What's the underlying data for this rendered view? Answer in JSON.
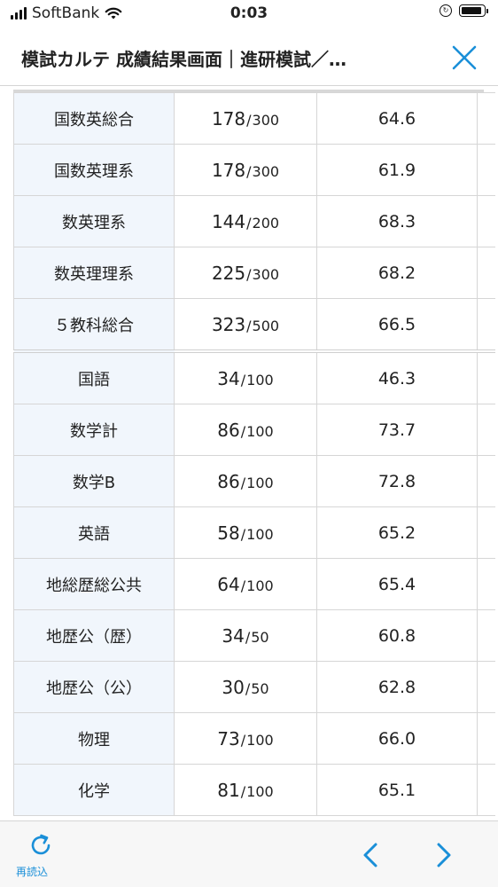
{
  "status_bar": {
    "carrier": "SoftBank",
    "time": "0:03"
  },
  "header": {
    "title": "模試カルテ 成績結果画面｜進研模試／…"
  },
  "table": {
    "rows": [
      {
        "subject": "国数英総合",
        "score": "178",
        "max": "300",
        "deviation": "64.6",
        "separator_before": false
      },
      {
        "subject": "国数英理系",
        "score": "178",
        "max": "300",
        "deviation": "61.9",
        "separator_before": false
      },
      {
        "subject": "数英理系",
        "score": "144",
        "max": "200",
        "deviation": "68.3",
        "separator_before": false
      },
      {
        "subject": "数英理理系",
        "score": "225",
        "max": "300",
        "deviation": "68.2",
        "separator_before": false
      },
      {
        "subject": "５教科総合",
        "score": "323",
        "max": "500",
        "deviation": "66.5",
        "separator_before": false
      },
      {
        "subject": "国語",
        "score": "34",
        "max": "100",
        "deviation": "46.3",
        "separator_before": true
      },
      {
        "subject": "数学計",
        "score": "86",
        "max": "100",
        "deviation": "73.7",
        "separator_before": false
      },
      {
        "subject": "数学B",
        "score": "86",
        "max": "100",
        "deviation": "72.8",
        "separator_before": false
      },
      {
        "subject": "英語",
        "score": "58",
        "max": "100",
        "deviation": "65.2",
        "separator_before": false
      },
      {
        "subject": "地総歴総公共",
        "score": "64",
        "max": "100",
        "deviation": "65.4",
        "separator_before": false
      },
      {
        "subject": "地歴公（歴）",
        "score": "34",
        "max": "50",
        "deviation": "60.8",
        "separator_before": false
      },
      {
        "subject": "地歴公（公）",
        "score": "30",
        "max": "50",
        "deviation": "62.8",
        "separator_before": false
      },
      {
        "subject": "物理",
        "score": "73",
        "max": "100",
        "deviation": "66.0",
        "separator_before": false
      },
      {
        "subject": "化学",
        "score": "81",
        "max": "100",
        "deviation": "65.1",
        "separator_before": false
      }
    ]
  },
  "toolbar": {
    "reload_label": "再読込"
  },
  "colors": {
    "accent": "#1a8fd8",
    "subject_cell_bg": "#f1f6fc",
    "border": "#d6d6d6"
  }
}
